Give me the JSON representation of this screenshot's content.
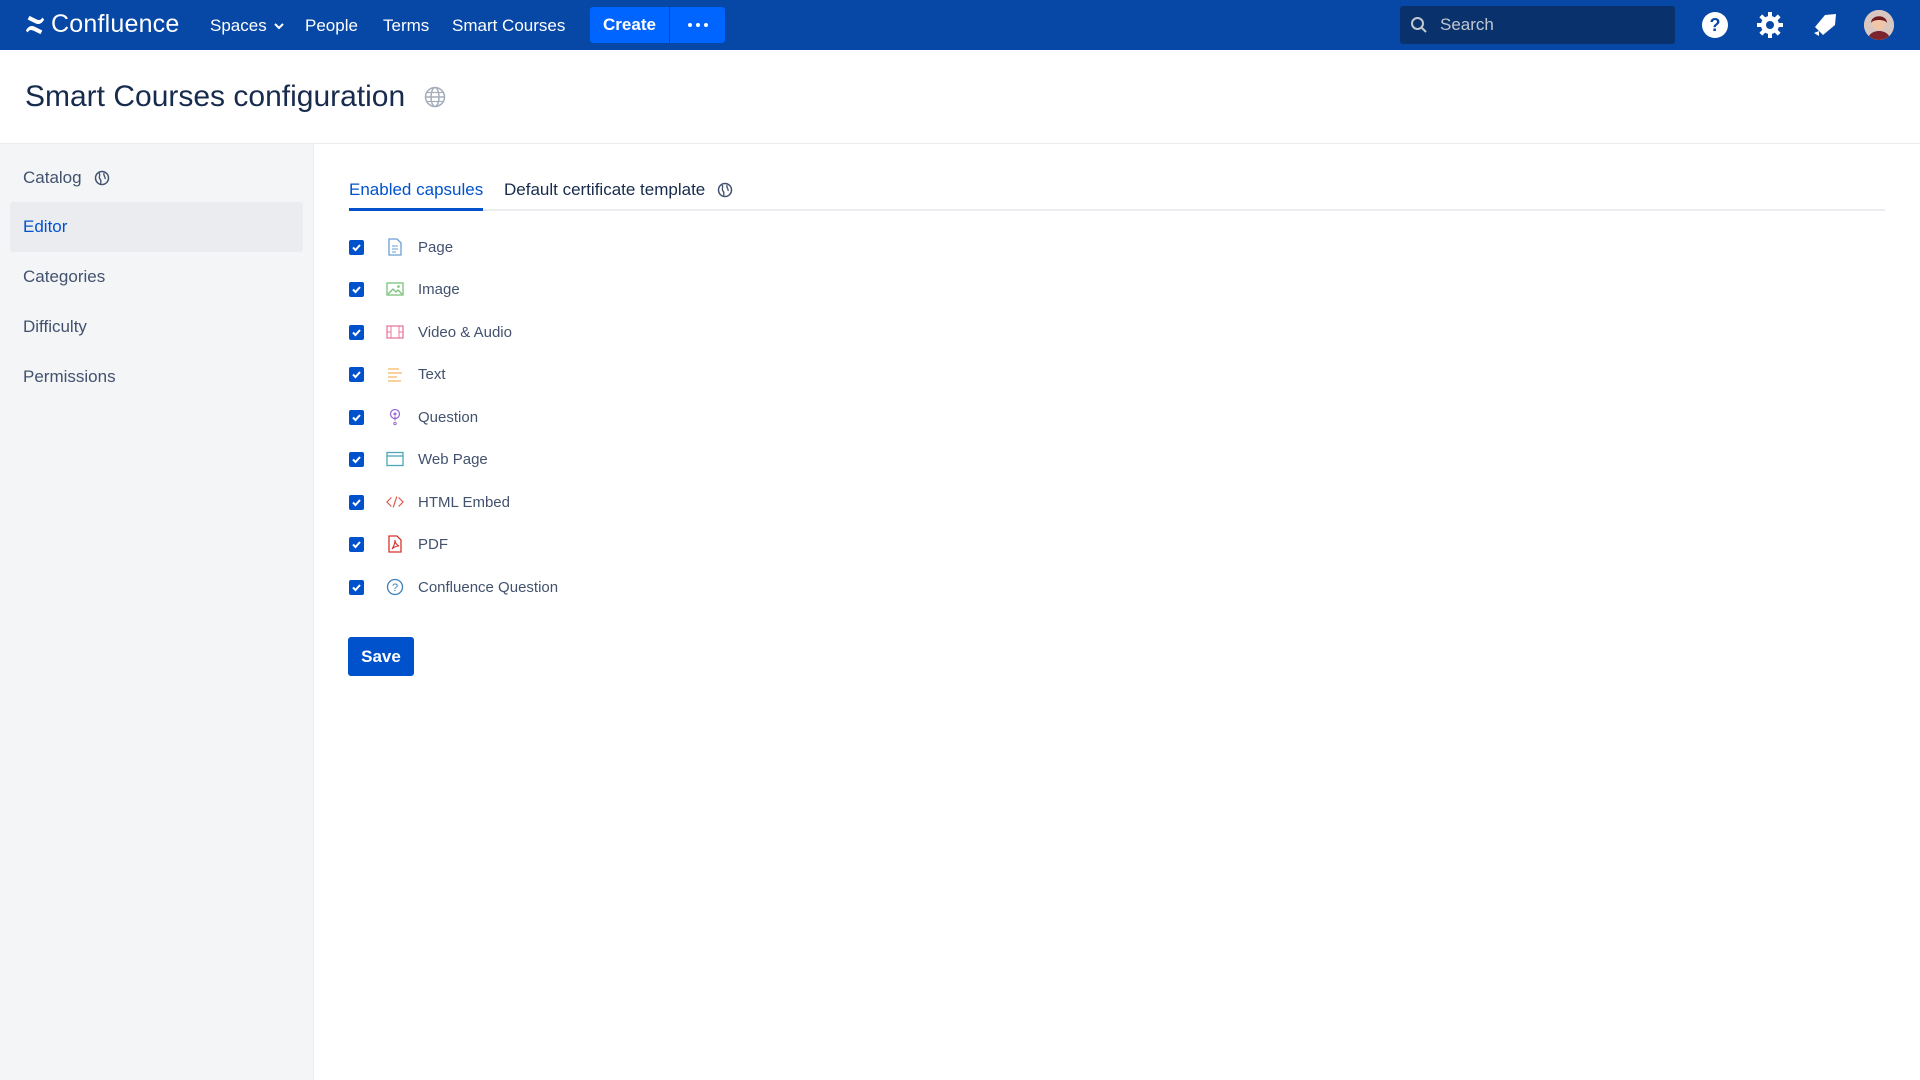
{
  "topnav": {
    "logo_text": "Confluence",
    "items": [
      {
        "label": "Spaces"
      },
      {
        "label": "People"
      },
      {
        "label": "Terms"
      },
      {
        "label": "Smart Courses"
      }
    ],
    "create_label": "Create",
    "search_placeholder": "Search",
    "icons": [
      "help-icon",
      "settings-icon",
      "notifications-icon"
    ],
    "colors": {
      "bar": "#0747a6",
      "create": "#0065ff"
    }
  },
  "page": {
    "title": "Smart Courses configuration"
  },
  "sidebar": {
    "items": [
      {
        "label": "Catalog",
        "has_globe": true
      },
      {
        "label": "Editor",
        "active": true
      },
      {
        "label": "Categories"
      },
      {
        "label": "Difficulty"
      },
      {
        "label": "Permissions"
      }
    ]
  },
  "tabs": [
    {
      "label": "Enabled capsules",
      "active": true
    },
    {
      "label": "Default certificate template",
      "active": false
    }
  ],
  "capsules": [
    {
      "label": "Page",
      "icon": "page-icon",
      "checked": true,
      "color": "#6b9fd4"
    },
    {
      "label": "Image",
      "icon": "image-icon",
      "checked": true,
      "color": "#7ac27a"
    },
    {
      "label": "Video & Audio",
      "icon": "video-icon",
      "checked": true,
      "color": "#e8799b"
    },
    {
      "label": "Text",
      "icon": "text-icon",
      "checked": true,
      "color": "#f5b967"
    },
    {
      "label": "Question",
      "icon": "question-icon",
      "checked": true,
      "color": "#9b6bd4"
    },
    {
      "label": "Web Page",
      "icon": "web-page-icon",
      "checked": true,
      "color": "#4aa8b8"
    },
    {
      "label": "HTML Embed",
      "icon": "code-icon",
      "checked": true,
      "color": "#e2524a"
    },
    {
      "label": "PDF",
      "icon": "pdf-icon",
      "checked": true,
      "color": "#d9322e"
    },
    {
      "label": "Confluence Question",
      "icon": "confluence-question-icon",
      "checked": true,
      "color": "#3b7fb8"
    }
  ],
  "save_label": "Save"
}
